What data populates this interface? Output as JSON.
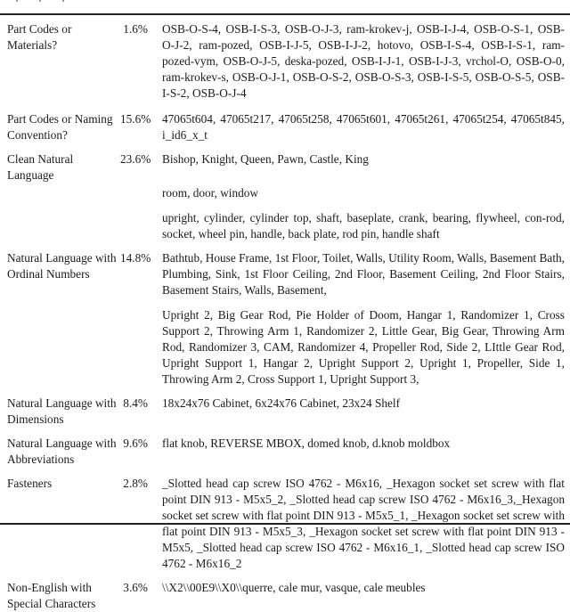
{
  "table": {
    "rows": [
      {
        "category": "Part Codes or Materials?",
        "percent": "1.6%",
        "examples": [
          "OSB-O-S-4, OSB-I-S-3, OSB-O-J-3, ram-krokev-j, OSB-I-J-4, OSB-O-S-1, OSB-O-J-2, ram-pozed, OSB-I-J-5, OSB-I-J-2, hotovo, OSB-I-S-4, OSB-I-S-1, ram-pozed-vym, OSB-O-J-5, deska-pozed, OSB-I-J-1, OSB-I-J-3, vrchol-O, OSB-O-0, ram-krokev-s, OSB-O-J-1, OSB-O-S-2, OSB-O-S-3, OSB-I-S-5, OSB-O-S-5, OSB-I-S-2, OSB-O-J-4"
        ]
      },
      {
        "category": "Part Codes or Naming Convention?",
        "percent": "15.6%",
        "examples": [
          "47065t604, 47065t217, 47065t258, 47065t601, 47065t261, 47065t254, 47065t845, i_id6_x_t"
        ]
      },
      {
        "category": "Clean Natural Language",
        "percent": "23.6%",
        "examples": [
          "Bishop, Knight, Queen, Pawn, Castle, King",
          "room, door, window",
          "upright, cylinder, cylinder top, shaft, baseplate, crank, bearing, flywheel, con-rod, socket, wheel pin, handle, back plate, rod pin, handle shaft"
        ]
      },
      {
        "category": "Natural Language with Ordinal Numbers",
        "percent": "14.8%",
        "examples": [
          "Bathtub, House Frame, 1st Floor, Toilet, Walls, Utility Room, Walls, Basement Bath, Plumbing, Sink, 1st Floor Ceiling, 2nd Floor, Basement Ceiling, 2nd Floor Stairs, Basement Stairs, Walls, Basement,",
          "Upright 2, Big Gear Rod, Pie Holder of Doom, Hangar 1, Randomizer 1, Cross Support 2, Throwing Arm 1, Randomizer 2, Little Gear, Big Gear, Throwing Arm Rod, Randomizer 3, CAM, Randomizer 4, Propeller Rod, Side 2, LIttle Gear Rod, Upright Support 1, Hangar 2, Upright Support 2, Upright 1, Propeller, Side 1, Throwing Arm 2, Cross Support 1, Upright Support 3,"
        ]
      },
      {
        "category": "Natural Language with Dimensions",
        "percent": "8.4%",
        "examples": [
          "18x24x76 Cabinet, 6x24x76 Cabinet, 23x24 Shelf"
        ]
      },
      {
        "category": "Natural Language with Abbreviations",
        "percent": "9.6%",
        "examples": [
          "flat knob, REVERSE MBOX, domed knob, d.knob moldbox"
        ]
      },
      {
        "category": "Fasteners",
        "percent": "2.8%",
        "examples": [
          "_Slotted head cap screw ISO 4762 - M6x16, _Hexagon socket set screw with flat point DIN 913 - M5x5_2, _Slotted head cap screw ISO 4762 - M6x16_3,_Hexagon socket set screw with flat point DIN 913 - M5x5_1, _Hexagon socket set screw with flat point DIN 913 - M5x5_3, _Hexagon socket set screw with flat point DIN 913 - M5x5, _Slotted head cap screw ISO 4762 - M6x16_1, _Slotted head cap screw ISO 4762 - M6x16_2"
        ]
      },
      {
        "category": "Non-English with Special Characters",
        "percent": "3.6%",
        "examples": [
          "\\\\X2\\\\00E9\\\\X0\\\\querre, cale mur, vasque, cale meubles"
        ]
      }
    ]
  }
}
